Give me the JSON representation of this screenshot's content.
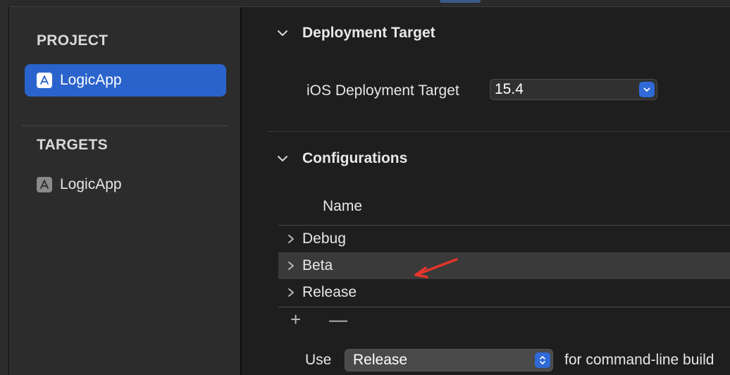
{
  "sidebar": {
    "project_header": "PROJECT",
    "project_item": "LogicApp",
    "targets_header": "TARGETS",
    "target_item": "LogicApp"
  },
  "deployment": {
    "title": "Deployment Target",
    "field_label": "iOS Deployment Target",
    "value": "15.4"
  },
  "configurations": {
    "title": "Configurations",
    "column_header": "Name",
    "rows": [
      {
        "label": "Debug"
      },
      {
        "label": "Beta"
      },
      {
        "label": "Release"
      }
    ],
    "add_symbol": "+",
    "remove_symbol": "—",
    "use_label": "Use",
    "use_value": "Release",
    "use_suffix": "for command-line build"
  },
  "colors": {
    "selection": "#2a63cc",
    "annotation_arrow": "#e5352b"
  },
  "icons": {
    "project_icon": "app-store-a-icon",
    "target_icon": "app-store-a-icon",
    "disclosure": "chevron-right-icon",
    "collapse": "chevron-down-icon"
  }
}
